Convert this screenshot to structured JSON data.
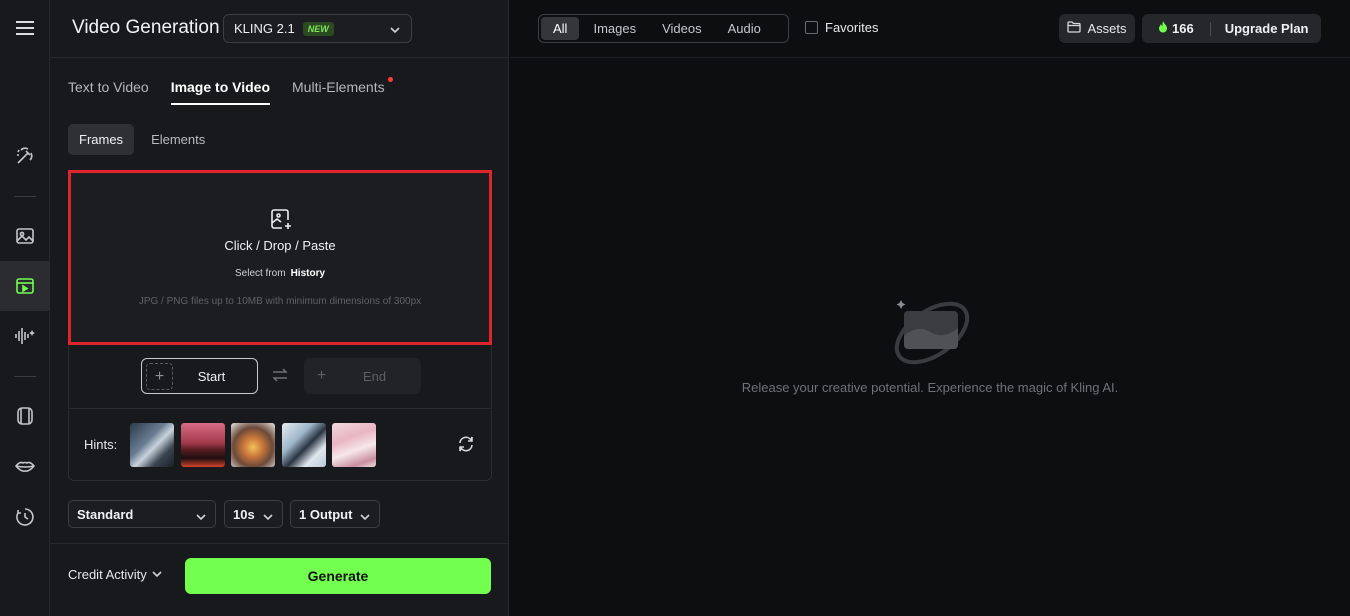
{
  "panel": {
    "title": "Video Generation",
    "model": {
      "name": "KLING 2.1",
      "badge": "NEW"
    },
    "tabs": [
      "Text to Video",
      "Image to Video",
      "Multi-Elements"
    ],
    "subtabs": [
      "Frames",
      "Elements"
    ],
    "upload": {
      "main": "Click / Drop / Paste",
      "select_prefix": "Select from",
      "select_link": "History",
      "hint": "JPG / PNG files up to 10MB with minimum dimensions of 300px"
    },
    "frames": {
      "start": "Start",
      "end": "End"
    },
    "hints_label": "Hints:",
    "selects": {
      "mode": "Standard",
      "duration": "10s",
      "outputs": "1 Output"
    },
    "credit_activity": "Credit Activity",
    "generate": "Generate"
  },
  "top": {
    "filters": [
      "All",
      "Images",
      "Videos",
      "Audio"
    ],
    "favorites": "Favorites",
    "assets": "Assets",
    "credits": "166",
    "upgrade": "Upgrade Plan"
  },
  "empty_state": "Release your creative potential. Experience the magic of Kling AI.",
  "colors": {
    "accent": "#72ff4f",
    "highlight": "#e0242c",
    "new_badge": "#7fe35a",
    "dot": "#ff3b3b"
  },
  "icons": [
    "menu-icon",
    "magic-wand-icon",
    "image-icon",
    "video-icon",
    "audio-icon",
    "avatar-icon",
    "lips-icon",
    "history-icon",
    "upload-image-icon",
    "swap-icon",
    "refresh-icon",
    "folder-icon",
    "flame-icon",
    "chevron-down-icon"
  ]
}
